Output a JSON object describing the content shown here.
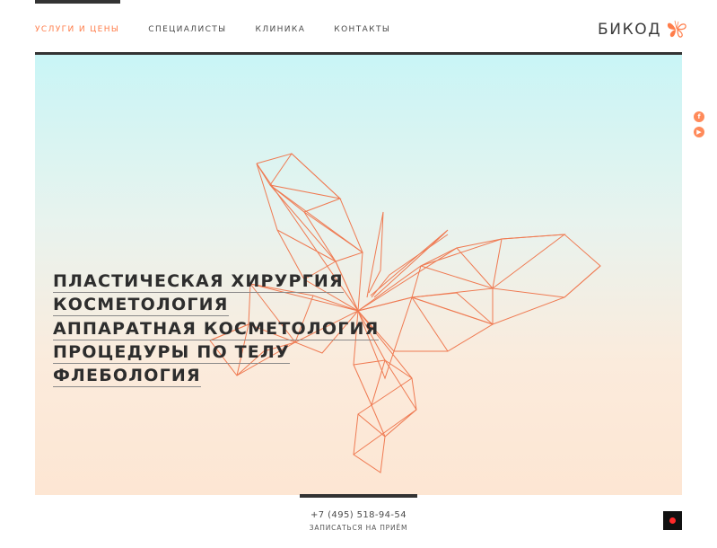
{
  "nav": {
    "items": [
      {
        "label": "УСЛУГИ И ЦЕНЫ",
        "active": true
      },
      {
        "label": "СПЕЦИАЛИСТЫ",
        "active": false
      },
      {
        "label": "КЛИНИКА",
        "active": false
      },
      {
        "label": "КОНТАКТЫ",
        "active": false
      }
    ]
  },
  "brand": {
    "name": "БИКОД",
    "icon": "butterfly-icon"
  },
  "hero": {
    "services": [
      "ПЛАСТИЧЕСКАЯ ХИРУРГИЯ",
      "КОСМЕТОЛОГИЯ",
      "АППАРАТНАЯ КОСМЕТОЛОГИЯ",
      "ПРОЦЕДУРЫ ПО ТЕЛУ",
      "ФЛЕБОЛОГИЯ"
    ],
    "illustration": "butterfly-wireframe"
  },
  "social": {
    "items": [
      "f",
      "▶"
    ]
  },
  "footer": {
    "phone": "+7 (495) 518-94-54",
    "appointment_label": "ЗАПИСАТЬСЯ НА ПРИЁМ"
  },
  "colors": {
    "accent": "#ff7d4a",
    "text": "#2d2d2d",
    "hero_top": "#c9f5f6",
    "hero_bottom": "#fde6d3"
  }
}
